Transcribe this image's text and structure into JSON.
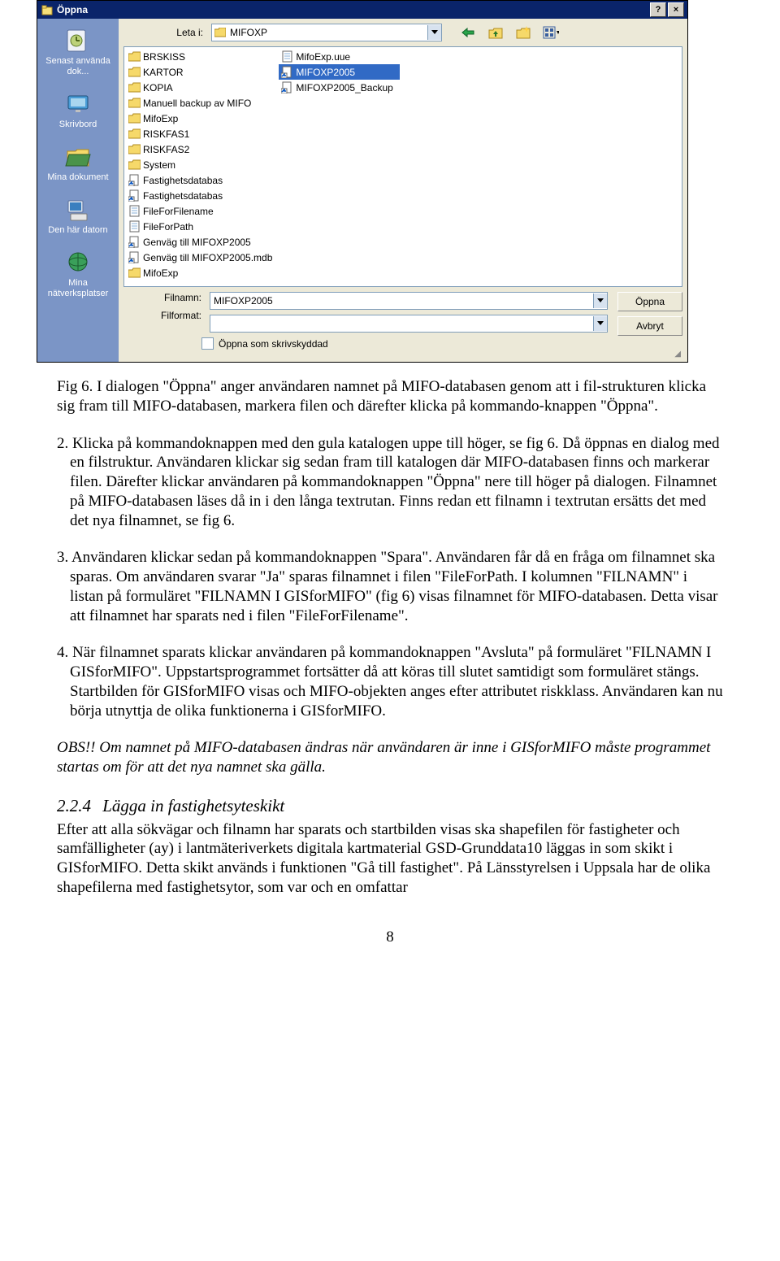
{
  "dialog": {
    "title": "Öppna",
    "look_in_label": "Leta i:",
    "look_in_value": "MIFOXP",
    "filename_label": "Filnamn:",
    "filename_value": "MIFOXP2005",
    "filetype_label": "Filformat:",
    "filetype_value": "",
    "readonly_label": "Öppna som skrivskyddad",
    "open_btn": "Öppna",
    "cancel_btn": "Avbryt",
    "places": [
      "Senast\nanvända dok...",
      "Skrivbord",
      "Mina dokument",
      "Den här datorn",
      "Mina\nnätverksplatser"
    ],
    "files_col1": [
      {
        "name": "BRSKISS",
        "type": "folder"
      },
      {
        "name": "KARTOR",
        "type": "folder"
      },
      {
        "name": "KOPIA",
        "type": "folder"
      },
      {
        "name": "Manuell backup av MIFO",
        "type": "folder"
      },
      {
        "name": "MifoExp",
        "type": "folder"
      },
      {
        "name": "RISKFAS1",
        "type": "folder"
      },
      {
        "name": "RISKFAS2",
        "type": "folder"
      },
      {
        "name": "System",
        "type": "folder"
      },
      {
        "name": "Fastighetsdatabas",
        "type": "shortcut"
      },
      {
        "name": "Fastighetsdatabas",
        "type": "shortcut"
      },
      {
        "name": "FileForFilename",
        "type": "file"
      },
      {
        "name": "FileForPath",
        "type": "file"
      },
      {
        "name": "Genväg till MIFOXP2005",
        "type": "shortcut"
      },
      {
        "name": "Genväg till MIFOXP2005.mdb",
        "type": "shortcut"
      }
    ],
    "files_col2": [
      {
        "name": "MifoExp",
        "type": "folder"
      },
      {
        "name": "MifoExp.uue",
        "type": "file"
      },
      {
        "name": "MIFOXP2005",
        "type": "shortcut",
        "selected": true
      },
      {
        "name": "MIFOXP2005_Backup",
        "type": "shortcut"
      }
    ]
  },
  "text": {
    "caption": "Fig 6. I dialogen \"Öppna\" anger användaren namnet på MIFO-databasen genom att i fil-strukturen klicka sig fram till MIFO-databasen, markera filen och därefter klicka på kommando-knappen \"Öppna\".",
    "item2": "2.  Klicka på kommandoknappen med den gula katalogen uppe till höger, se fig 6. Då öppnas en dialog med en filstruktur. Användaren klickar sig sedan fram till katalogen där MIFO-databasen finns och markerar filen. Därefter klickar användaren på kommandoknappen \"Öppna\" nere till höger på dialogen. Filnamnet på MIFO-databasen läses då in i den långa textrutan. Finns redan ett filnamn i textrutan ersätts det med det nya filnamnet, se fig 6.",
    "item3": "3.  Användaren klickar sedan på kommandoknappen \"Spara\". Användaren får då en fråga om filnamnet ska sparas. Om användaren svarar \"Ja\" sparas filnamnet i filen \"FileForPath. I kolumnen \"FILNAMN\" i listan på formuläret \"FILNAMN I GISforMIFO\" (fig 6) visas filnamnet för MIFO-databasen. Detta visar att filnamnet har sparats ned i filen \"FileForFilename\".",
    "item4": "4.   När filnamnet sparats klickar användaren på kommandoknappen \"Avsluta\" på formuläret \"FILNAMN I GISforMIFO\". Uppstartsprogrammet fortsätter då att köras till slutet samtidigt som formuläret stängs. Startbilden för GISforMIFO visas och MIFO-objekten anges efter attributet riskklass. Användaren kan nu börja utnyttja de olika funktionerna i GISforMIFO.",
    "obs": "OBS!! Om namnet på MIFO-databasen ändras när användaren är inne i GISforMIFO måste programmet startas om för att det nya namnet ska gälla.",
    "sect_num": "2.2.4",
    "sect_title": "Lägga in fastighetsyteskikt",
    "sect_body": "Efter att alla sökvägar och filnamn har sparats och startbilden visas ska shapefilen för fastigheter och samfälligheter (ay) i lantmäteriverkets digitala kartmaterial GSD-Grunddata10 läggas in som skikt i GISforMIFO. Detta skikt används i funktionen \"Gå till fastighet\". På Länsstyrelsen i Uppsala har de olika shapefilerna med fastighetsytor, som var och en omfattar",
    "page": "8"
  }
}
